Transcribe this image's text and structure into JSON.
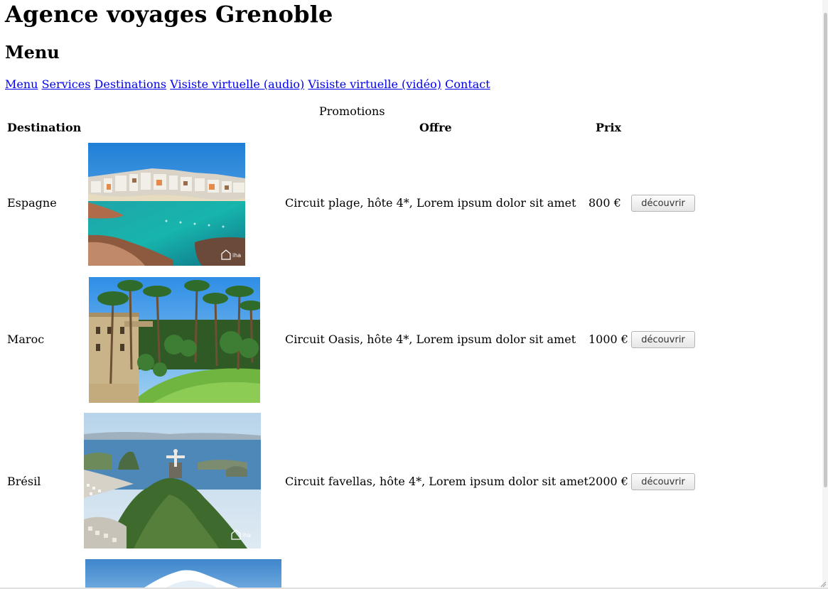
{
  "page": {
    "title": "Agence voyages Grenoble",
    "subtitle": "Menu"
  },
  "nav": {
    "items": [
      {
        "label": "Menu"
      },
      {
        "label": "Services"
      },
      {
        "label": "Destinations"
      },
      {
        "label": "Visiste virtuelle (audio)"
      },
      {
        "label": "Visiste virtuelle (vidéo)"
      },
      {
        "label": "Contact"
      }
    ]
  },
  "table": {
    "caption": "Promotions",
    "headers": {
      "destination": "Destination",
      "offre": "Offre",
      "prix": "Prix"
    },
    "rows": [
      {
        "destination": "Espagne",
        "offre": "Circuit plage, hôte 4*, Lorem ipsum dolor sit amet",
        "prix": "800 €",
        "button": "découvrir",
        "photo": "coastal-village-beach",
        "watermark": "iha"
      },
      {
        "destination": "Maroc",
        "offre": "Circuit Oasis, hôte 4*, Lorem ipsum dolor sit amet",
        "prix": "1000 €",
        "button": "découvrir",
        "photo": "palm-garden-oasis"
      },
      {
        "destination": "Brésil",
        "offre": "Circuit favellas, hôte 4*, Lorem ipsum dolor sit amet",
        "prix": "2000 €",
        "button": "découvrir",
        "photo": "rio-corcovado-view",
        "watermark": "iha"
      },
      {
        "photo": "snowy-mountain-peak"
      }
    ]
  },
  "colors": {
    "link": "#0000ee",
    "background": "#ffffff"
  }
}
